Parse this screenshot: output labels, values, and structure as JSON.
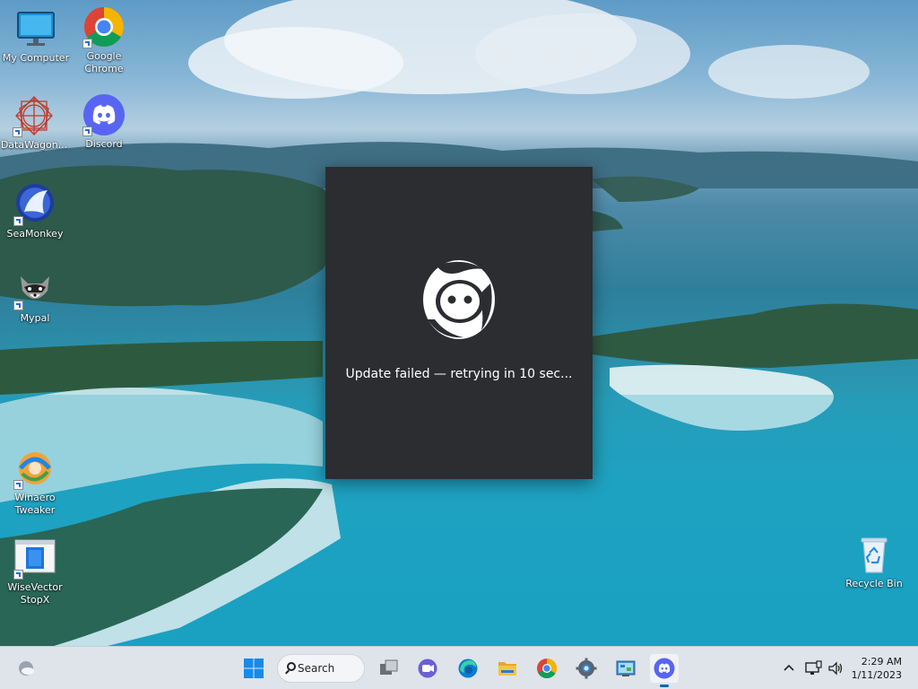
{
  "desktop": {
    "icons": [
      {
        "label": "My Computer"
      },
      {
        "label": "Google Chrome"
      },
      {
        "label": "DataWagon..."
      },
      {
        "label": "Discord"
      },
      {
        "label": "SeaMonkey"
      },
      {
        "label": "Mypal"
      },
      {
        "label": "Winaero Tweaker"
      },
      {
        "label": "WiseVector StopX"
      },
      {
        "label": "Recycle Bin"
      }
    ]
  },
  "splash": {
    "status": "Update failed — retrying in 10 sec..."
  },
  "taskbar": {
    "search_label": "Search",
    "time": "2:29 AM",
    "date": "1/11/2023",
    "apps": [
      "widgets",
      "start",
      "search",
      "task-view",
      "teams-chat",
      "edge",
      "file-explorer",
      "chrome",
      "settings",
      "control-panel",
      "discord"
    ],
    "active_app": "discord"
  },
  "colors": {
    "splash_bg": "#2b2d31",
    "discord_blurple": "#5865f2",
    "taskbar_bg": "#dfe4ea",
    "accent": "#0067c0"
  }
}
